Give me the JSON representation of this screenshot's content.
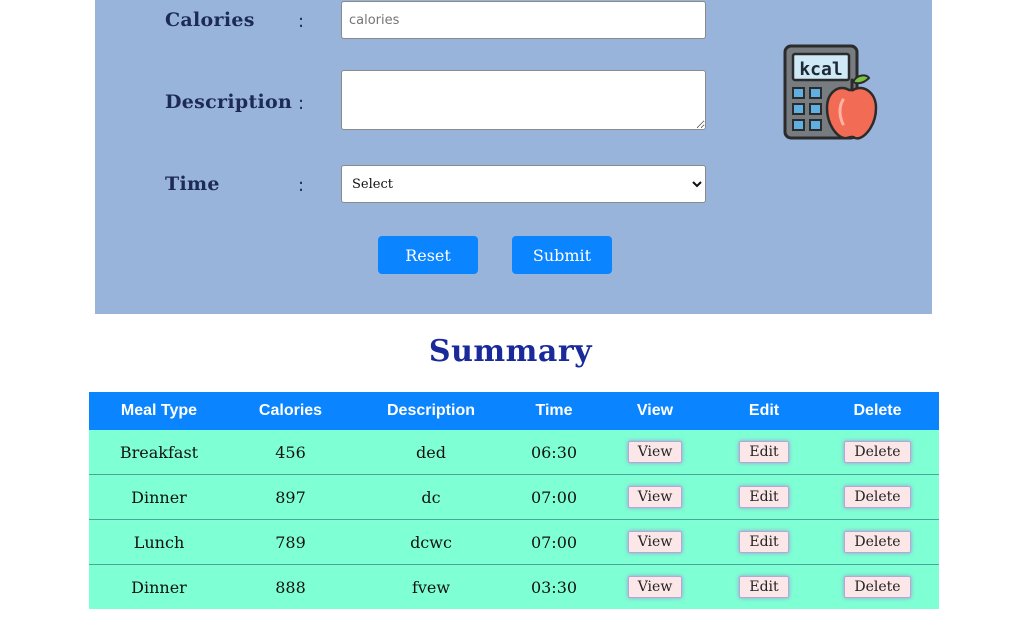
{
  "form": {
    "calories_label": "Calories",
    "description_label": "Description",
    "time_label": "Time",
    "colon": ":",
    "calories_placeholder": "calories",
    "calories_value": "",
    "description_value": "",
    "time_selected": "Select",
    "reset_label": "Reset",
    "submit_label": "Submit",
    "icon": "kcal-calculator-apple-icon",
    "icon_text": "kcal"
  },
  "summary": {
    "title": "Summary",
    "headers": [
      "Meal Type",
      "Calories",
      "Description",
      "Time",
      "View",
      "Edit",
      "Delete"
    ],
    "rows": [
      {
        "meal_type": "Breakfast",
        "calories": "456",
        "description": "ded",
        "time": "06:30",
        "view": "View",
        "edit": "Edit",
        "delete": "Delete"
      },
      {
        "meal_type": "Dinner",
        "calories": "897",
        "description": "dc",
        "time": "07:00",
        "view": "View",
        "edit": "Edit",
        "delete": "Delete"
      },
      {
        "meal_type": "Lunch",
        "calories": "789",
        "description": "dcwc",
        "time": "07:00",
        "view": "View",
        "edit": "Edit",
        "delete": "Delete"
      },
      {
        "meal_type": "Dinner",
        "calories": "888",
        "description": "fvew",
        "time": "03:30",
        "view": "View",
        "edit": "Edit",
        "delete": "Delete"
      }
    ]
  },
  "colors": {
    "form_panel": "#98b4db",
    "button": "#0a84ff",
    "table_header": "#0a84ff",
    "table_row": "#7fffd4",
    "title": "#1a2a9a"
  }
}
